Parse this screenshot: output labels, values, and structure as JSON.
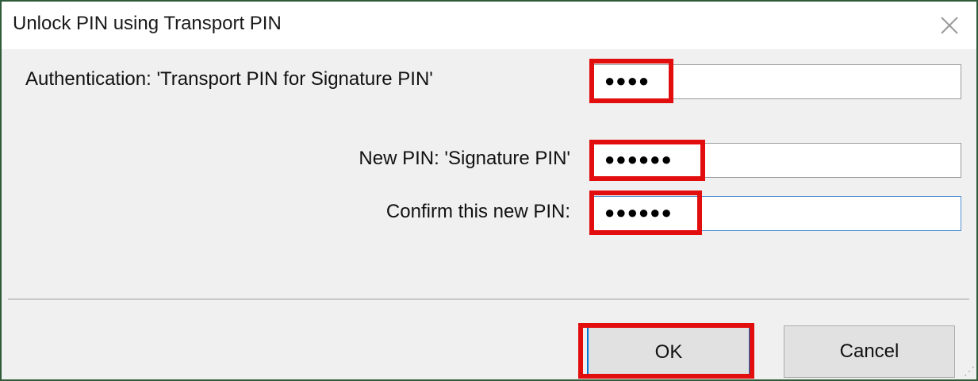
{
  "dialog": {
    "title": "Unlock PIN using Transport PIN",
    "close_icon": "close-icon"
  },
  "fields": {
    "auth": {
      "label": "Authentication: 'Transport PIN for Signature PIN'",
      "value": "●●●●"
    },
    "new_pin": {
      "label": "New PIN: 'Signature PIN'",
      "value": "●●●●●●"
    },
    "confirm_pin": {
      "label": "Confirm this new PIN:",
      "value": "●●●●●●"
    }
  },
  "buttons": {
    "ok_label": "OK",
    "cancel_label": "Cancel"
  },
  "colors": {
    "highlight": "#e20d0d",
    "window_border": "#2f5b3a",
    "dialog_bg": "#f0f0f0"
  }
}
